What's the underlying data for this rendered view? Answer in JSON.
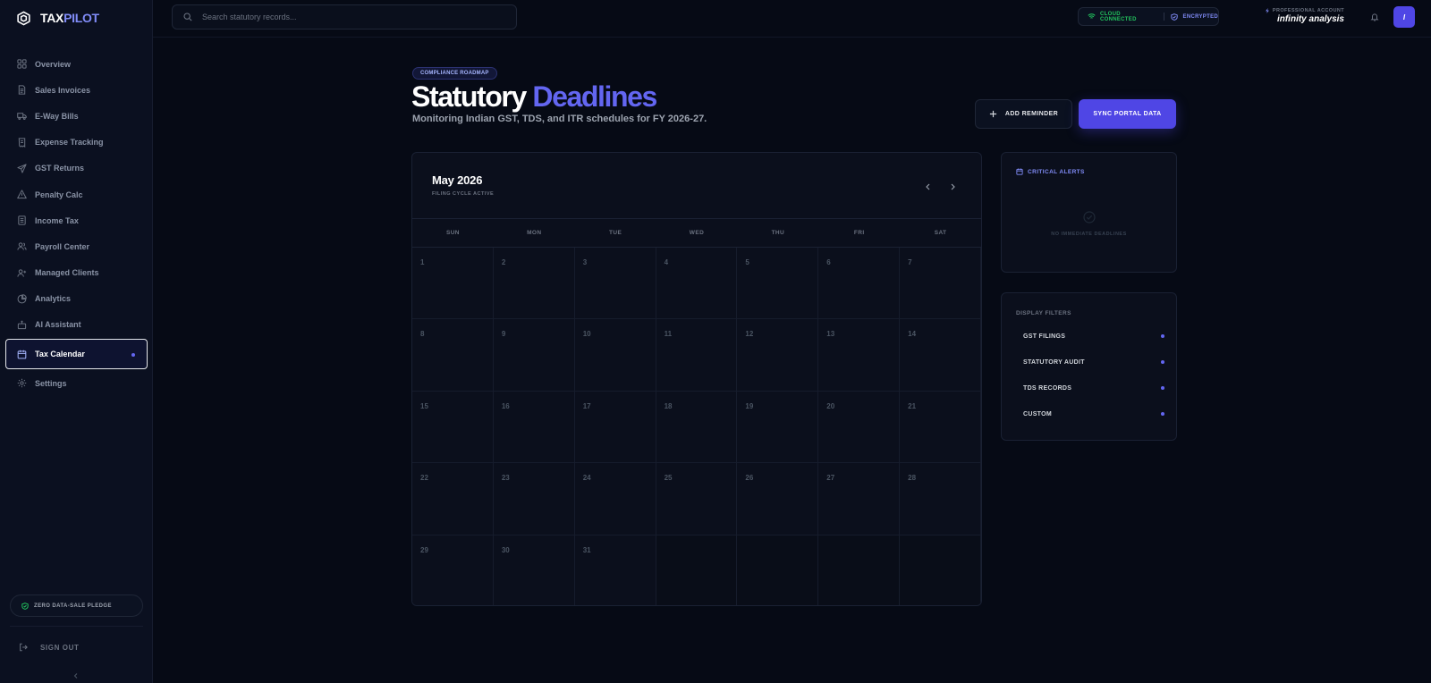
{
  "app": {
    "name_main": "TAX",
    "name_accent": "PILOT"
  },
  "sidebar": {
    "items": [
      {
        "label": "Overview",
        "icon": "grid-icon"
      },
      {
        "label": "Sales Invoices",
        "icon": "document-icon"
      },
      {
        "label": "E-Way Bills",
        "icon": "truck-icon"
      },
      {
        "label": "Expense Tracking",
        "icon": "receipt-icon"
      },
      {
        "label": "GST Returns",
        "icon": "send-icon"
      },
      {
        "label": "Penalty Calc",
        "icon": "warning-icon"
      },
      {
        "label": "Income Tax",
        "icon": "file-icon"
      },
      {
        "label": "Payroll Center",
        "icon": "users-icon"
      },
      {
        "label": "Managed Clients",
        "icon": "user-plus-icon"
      },
      {
        "label": "Analytics",
        "icon": "pie-icon"
      },
      {
        "label": "AI Assistant",
        "icon": "bot-icon"
      },
      {
        "label": "Tax Calendar",
        "icon": "calendar-icon",
        "active": true
      },
      {
        "label": "Settings",
        "icon": "gear-icon"
      }
    ],
    "pledge": "ZERO DATA-SALE PLEDGE",
    "signout": "SIGN OUT"
  },
  "topbar": {
    "search_placeholder": "Search statutory records...",
    "status_cloud": "CLOUD CONNECTED",
    "status_encrypted": "ENCRYPTED",
    "account_type": "PROFESSIONAL ACCOUNT",
    "account_name": "infinity analysis",
    "avatar_initial": "I"
  },
  "header": {
    "tag": "COMPLIANCE ROADMAP",
    "title_main": "Statutory",
    "title_accent": "Deadlines",
    "subtitle": "Monitoring Indian GST, TDS, and ITR schedules for FY 2026-27.",
    "add_reminder": "ADD REMINDER",
    "sync": "SYNC PORTAL DATA"
  },
  "calendar": {
    "month": "May 2026",
    "cycle": "FILING CYCLE ACTIVE",
    "weekdays": [
      "SUN",
      "MON",
      "TUE",
      "WED",
      "THU",
      "FRI",
      "SAT"
    ],
    "days": [
      "1",
      "2",
      "3",
      "4",
      "5",
      "6",
      "7",
      "8",
      "9",
      "10",
      "11",
      "12",
      "13",
      "14",
      "15",
      "16",
      "17",
      "18",
      "19",
      "20",
      "21",
      "22",
      "23",
      "24",
      "25",
      "26",
      "27",
      "28",
      "29",
      "30",
      "31"
    ]
  },
  "alerts": {
    "title": "CRITICAL ALERTS",
    "empty": "NO IMMEDIATE DEADLINES"
  },
  "filters": {
    "title": "DISPLAY FILTERS",
    "items": [
      "GST FILINGS",
      "STATUTORY AUDIT",
      "TDS RECORDS",
      "CUSTOM"
    ]
  },
  "colors": {
    "accent": "#6366f1",
    "success": "#22c55e",
    "background": "#060a15"
  }
}
